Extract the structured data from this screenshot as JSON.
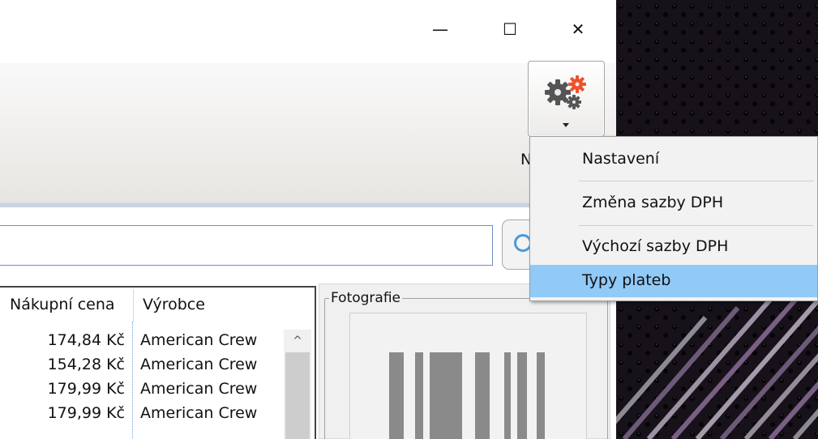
{
  "window": {
    "minimize_glyph": "—",
    "maximize_glyph": "☐",
    "close_glyph": "✕"
  },
  "ribbon": {
    "partial_label": "N",
    "settings_button_icon": "gears-icon"
  },
  "menu": {
    "items": [
      {
        "label": "Nastavení"
      },
      {
        "label": "Změna sazby DPH"
      },
      {
        "label": "Výchozí sazby DPH"
      },
      {
        "label": "Typy plateb"
      }
    ],
    "highlighted": "Typy plateb"
  },
  "search": {
    "value": "",
    "button_icon": "refresh-icon"
  },
  "table": {
    "columns": [
      "Nákupní cena",
      "Výrobce"
    ],
    "rows": [
      {
        "price": "174,84 Kč",
        "maker": "American Crew"
      },
      {
        "price": "154,28 Kč",
        "maker": "American Crew"
      },
      {
        "price": "179,99 Kč",
        "maker": "American Crew"
      },
      {
        "price": "179,99 Kč",
        "maker": "American Crew"
      }
    ],
    "scroll_up_glyph": "^"
  },
  "photo": {
    "label": "Fotografie"
  },
  "colors": {
    "menu_highlight": "#91c9f7",
    "gear_accent": "#f0522b",
    "input_border": "#6c8ec4"
  }
}
